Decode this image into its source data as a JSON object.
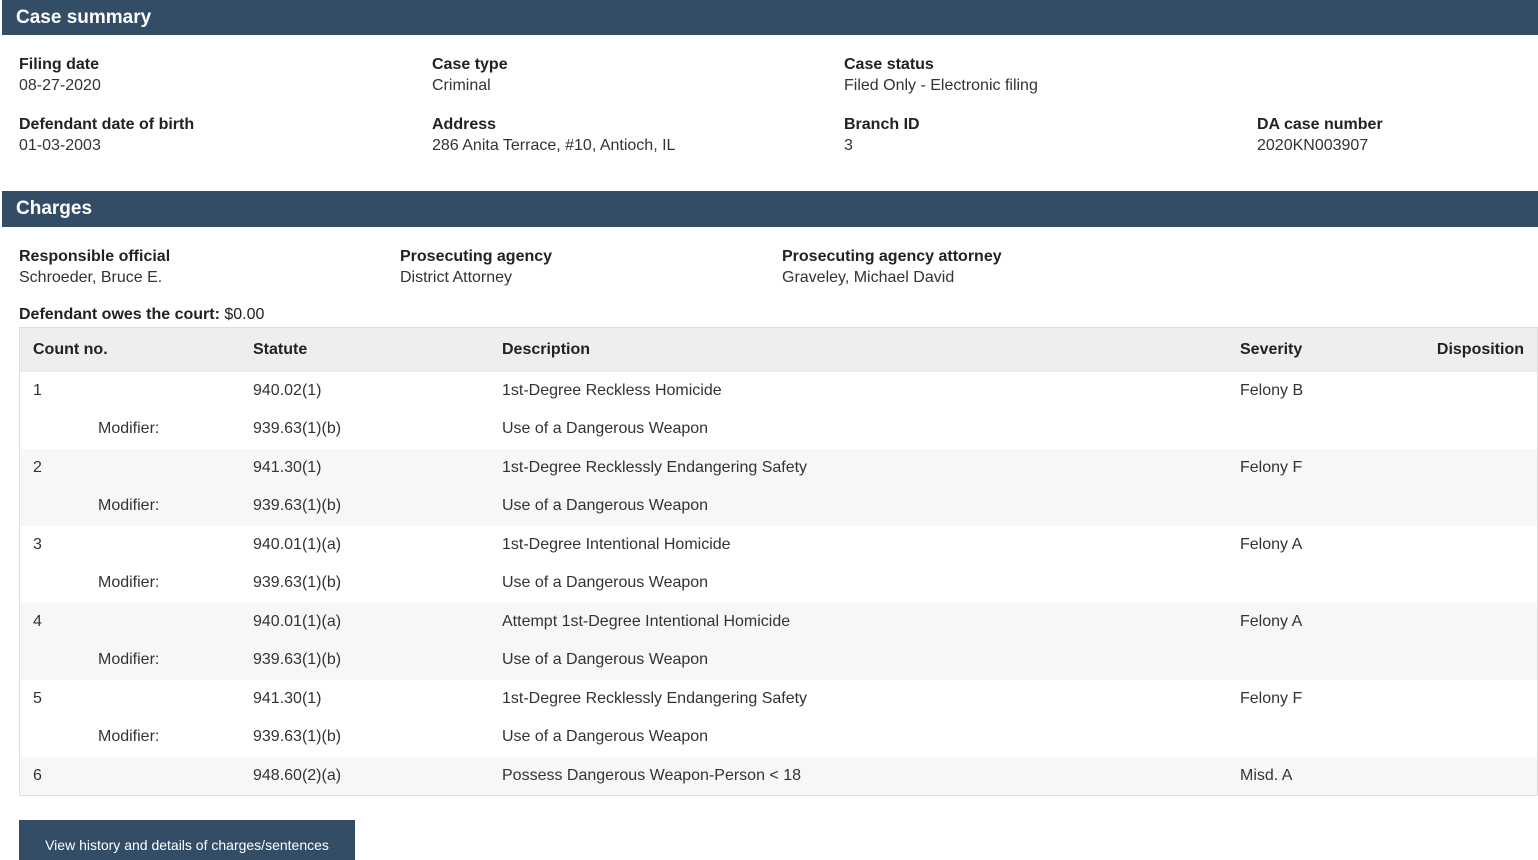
{
  "case_summary": {
    "header": "Case summary",
    "fields": [
      {
        "label": "Filing date",
        "value": "08-27-2020"
      },
      {
        "label": "Case type",
        "value": "Criminal"
      },
      {
        "label": "Case status",
        "value": "Filed Only - Electronic filing"
      },
      {
        "label": "Defendant date of birth",
        "value": "01-03-2003"
      },
      {
        "label": "Address",
        "value": "286 Anita Terrace, #10, Antioch, IL"
      },
      {
        "label": "Branch ID",
        "value": "3"
      },
      {
        "label": "DA case number",
        "value": "2020KN003907"
      }
    ]
  },
  "charges": {
    "header": "Charges",
    "fields": [
      {
        "label": "Responsible official",
        "value": "Schroeder, Bruce E."
      },
      {
        "label": "Prosecuting agency",
        "value": "District Attorney"
      },
      {
        "label": "Prosecuting agency attorney",
        "value": "Graveley, Michael David"
      }
    ],
    "owes_label": "Defendant owes the court:",
    "owes_value": " $0.00",
    "columns": [
      "Count no.",
      "Statute",
      "Description",
      "Severity",
      "Disposition"
    ],
    "modifier_label": "Modifier:",
    "rows": [
      {
        "count": "1",
        "statute": "940.02(1)",
        "description": "1st-Degree Reckless Homicide",
        "severity": "Felony B",
        "disposition": "",
        "modifier_statute": "939.63(1)(b)",
        "modifier_description": "Use of a Dangerous Weapon"
      },
      {
        "count": "2",
        "statute": "941.30(1)",
        "description": "1st-Degree Recklessly Endangering Safety",
        "severity": "Felony F",
        "disposition": "",
        "modifier_statute": "939.63(1)(b)",
        "modifier_description": "Use of a Dangerous Weapon"
      },
      {
        "count": "3",
        "statute": "940.01(1)(a)",
        "description": "1st-Degree Intentional Homicide",
        "severity": "Felony A",
        "disposition": "",
        "modifier_statute": "939.63(1)(b)",
        "modifier_description": "Use of a Dangerous Weapon"
      },
      {
        "count": "4",
        "statute": "940.01(1)(a)",
        "description": "Attempt 1st-Degree Intentional Homicide",
        "severity": "Felony A",
        "disposition": "",
        "modifier_statute": "939.63(1)(b)",
        "modifier_description": "Use of a Dangerous Weapon"
      },
      {
        "count": "5",
        "statute": "941.30(1)",
        "description": "1st-Degree Recklessly Endangering Safety",
        "severity": "Felony F",
        "disposition": "",
        "modifier_statute": "939.63(1)(b)",
        "modifier_description": "Use of a Dangerous Weapon"
      },
      {
        "count": "6",
        "statute": "948.60(2)(a)",
        "description": "Possess Dangerous Weapon-Person < 18",
        "severity": "Misd. A",
        "disposition": "",
        "modifier_statute": null,
        "modifier_description": null
      }
    ],
    "history_button_label": "View history and details of charges/sentences"
  }
}
